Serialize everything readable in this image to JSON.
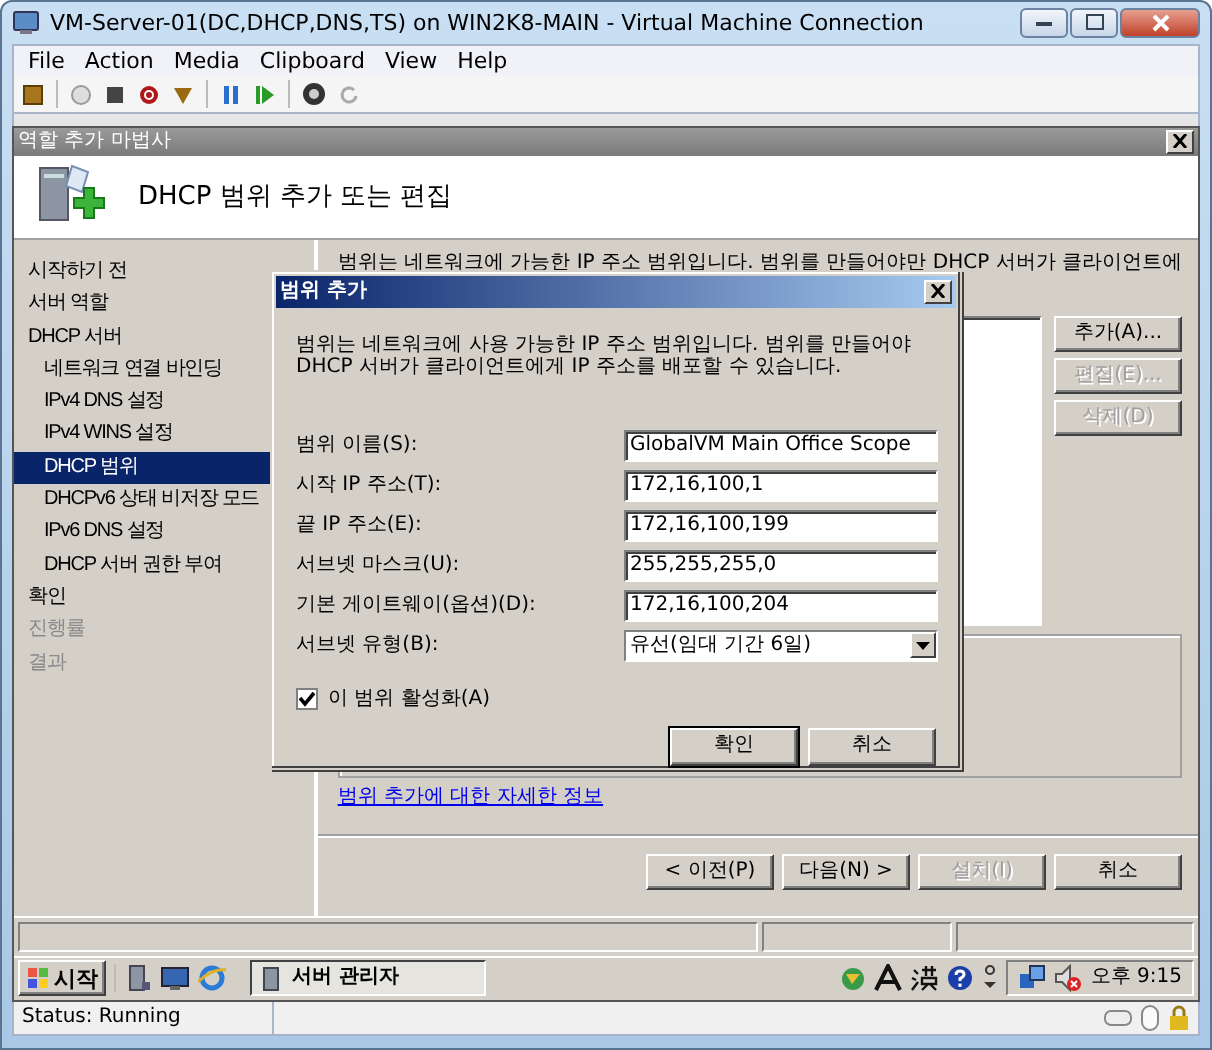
{
  "window": {
    "title": "VM-Server-01(DC,DHCP,DNS,TS) on WIN2K8-MAIN - Virtual Machine Connection"
  },
  "menu": [
    "File",
    "Action",
    "Media",
    "Clipboard",
    "View",
    "Help"
  ],
  "wizard": {
    "title": "역할 추가 마법사",
    "heading": "DHCP 범위 추가 또는 편집",
    "nav": [
      {
        "label": "시작하기 전",
        "selected": false,
        "disabled": false
      },
      {
        "label": "서버 역할",
        "selected": false,
        "disabled": false
      },
      {
        "label": "DHCP 서버",
        "selected": false,
        "disabled": false,
        "children": [
          {
            "label": "네트워크 연결 바인딩",
            "selected": false,
            "disabled": false
          },
          {
            "label": "IPv4 DNS 설정",
            "selected": false,
            "disabled": false
          },
          {
            "label": "IPv4 WINS 설정",
            "selected": false,
            "disabled": false
          },
          {
            "label": "DHCP 범위",
            "selected": true,
            "disabled": false
          },
          {
            "label": "DHCPv6 상태 비저장 모드",
            "selected": false,
            "disabled": false
          },
          {
            "label": "IPv6 DNS 설정",
            "selected": false,
            "disabled": false
          },
          {
            "label": "DHCP 서버 권한 부여",
            "selected": false,
            "disabled": false
          }
        ]
      },
      {
        "label": "확인",
        "selected": false,
        "disabled": false
      },
      {
        "label": "진행률",
        "selected": false,
        "disabled": true
      },
      {
        "label": "결과",
        "selected": false,
        "disabled": true
      }
    ],
    "intro_text": "범위는 네트워크에 가능한 IP 주소 범위입니다. 범위를 만들어야만 DHCP 서버가 클라이언트에",
    "scope_buttons": [
      {
        "label": "추가(A)...",
        "disabled": false
      },
      {
        "label": "편집(E)...",
        "disabled": true
      },
      {
        "label": "삭제(D)",
        "disabled": true
      }
    ],
    "link": "범위 추가에 대한 자세한 정보",
    "buttons": [
      {
        "label": "< 이전(P)",
        "disabled": false
      },
      {
        "label": "다음(N) >",
        "disabled": false
      },
      {
        "label": "설치(I)",
        "disabled": true
      },
      {
        "label": "취소",
        "disabled": false
      }
    ]
  },
  "dialog": {
    "title": "범위 추가",
    "description": "범위는 네트워크에 사용 가능한 IP 주소 범위입니다. 범위를 만들어야 DHCP 서버가 클라이언트에게 IP 주소를 배포할 수 있습니다.",
    "fields": [
      {
        "label": "범위 이름(S):",
        "value": "GlobalVM Main Office Scope",
        "kind": "text"
      },
      {
        "label": "시작 IP 주소(T):",
        "value": "172,16,100,1",
        "kind": "text"
      },
      {
        "label": "끝 IP 주소(E):",
        "value": "172,16,100,199",
        "kind": "text"
      },
      {
        "label": "서브넷 마스크(U):",
        "value": "255,255,255,0",
        "kind": "text"
      },
      {
        "label": "기본 게이트웨이(옵션)(D):",
        "value": "172,16,100,204",
        "kind": "text"
      },
      {
        "label": "서브넷 유형(B):",
        "value": "유선(임대 기간 6일)",
        "kind": "select"
      }
    ],
    "activate": {
      "label": "이 범위 활성화(A)",
      "checked": true
    },
    "buttons": [
      "확인",
      "취소"
    ]
  },
  "taskbar": {
    "start": "시작",
    "task": "서버 관리자",
    "clock": "오후 9:15"
  },
  "status_bar": "Status: Running"
}
